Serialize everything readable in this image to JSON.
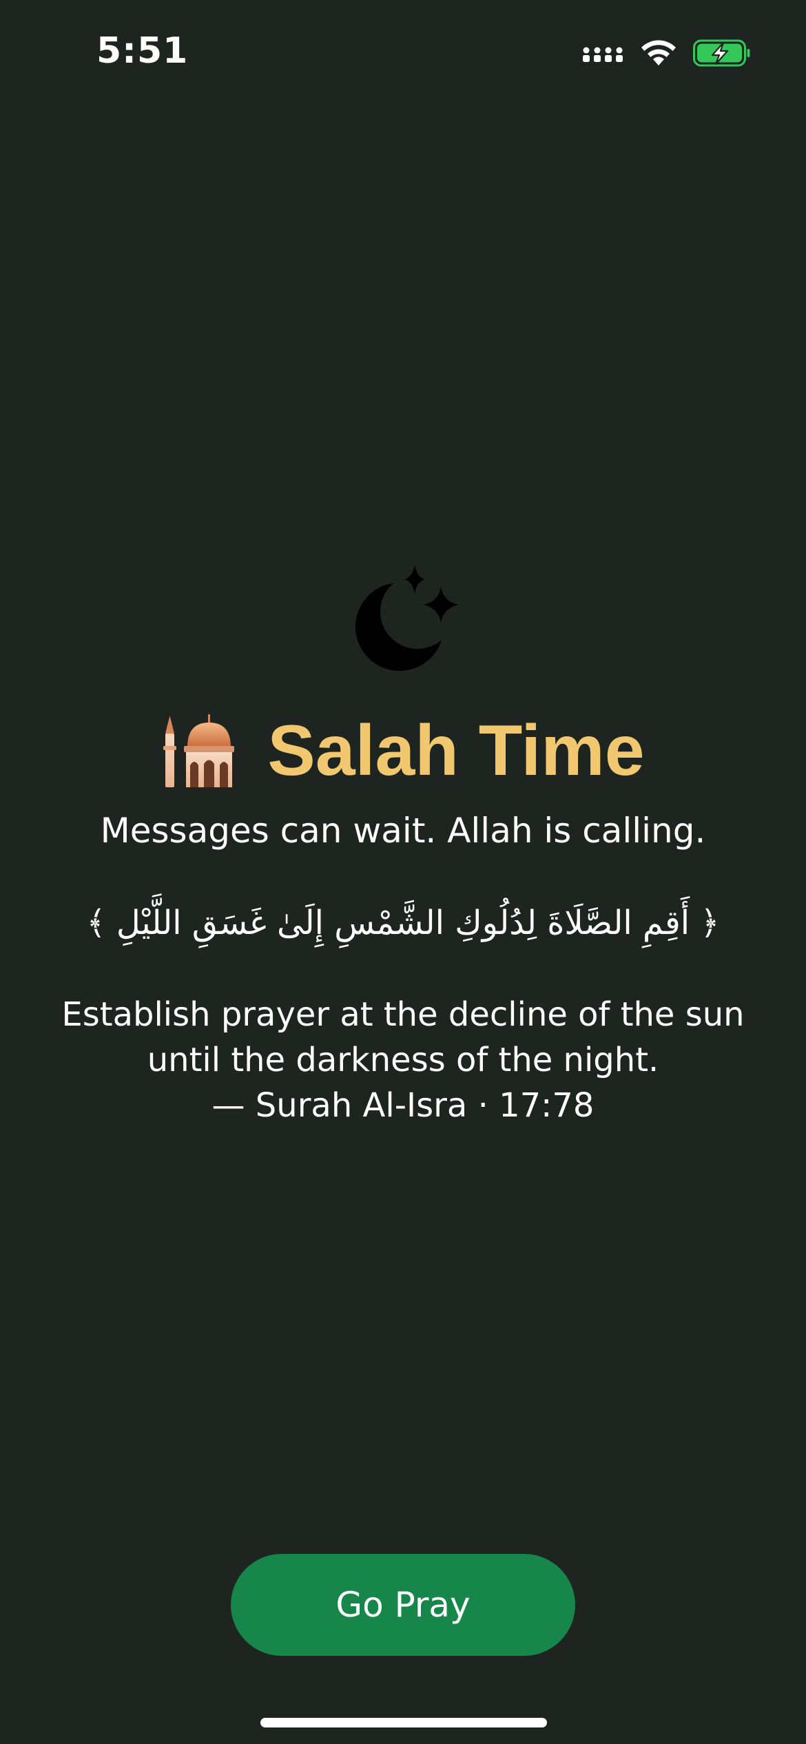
{
  "status_bar": {
    "time": "5:51",
    "icons": [
      "cellular-signal-icon",
      "wifi-icon",
      "battery-charging-icon"
    ],
    "battery_color": "#34c759"
  },
  "hero": {
    "moon_icon": "crescent-moon-stars-icon",
    "mosque_icon": "mosque-icon",
    "title": "Salah Time",
    "title_color": "#f1c86f",
    "tagline": "Messages can wait. Allah is calling."
  },
  "verse": {
    "arabic": "﴿ أَقِمِ الصَّلَاةَ لِدُلُوكِ الشَّمْسِ إِلَىٰ غَسَقِ اللَّيْلِ ﴾",
    "translation_line1": "Establish prayer at the decline of the sun",
    "translation_line2": "until the darkness of the night.",
    "reference": "— Surah Al-Isra · 17:78"
  },
  "actions": {
    "go_pray_label": "Go Pray",
    "button_color": "#17864a"
  },
  "colors": {
    "background": "#1e2521"
  }
}
